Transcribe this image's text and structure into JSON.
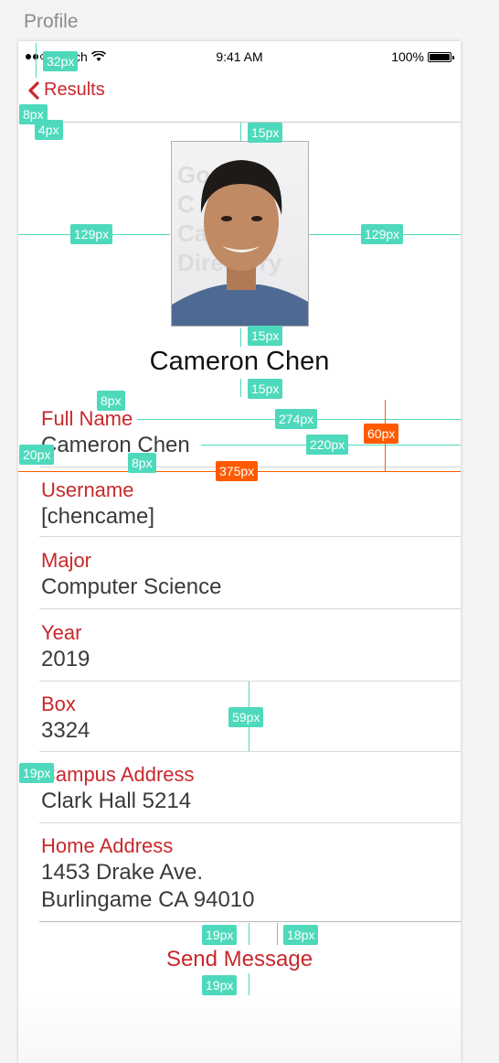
{
  "page_label": "Profile",
  "status_bar": {
    "carrier": "Sketch",
    "time": "9:41 AM",
    "battery": "100%"
  },
  "nav": {
    "back_label": "Results"
  },
  "photo": {
    "watermark_lines": [
      "Gordell",
      "C",
      "Campus",
      "Directory"
    ]
  },
  "profile": {
    "name": "Cameron Chen",
    "fields": [
      {
        "label": "Full Name",
        "value": "Cameron Chen"
      },
      {
        "label": "Username",
        "value": "[chencame]"
      },
      {
        "label": "Major",
        "value": "Computer Science"
      },
      {
        "label": "Year",
        "value": "2019"
      },
      {
        "label": "Box",
        "value": "3324"
      },
      {
        "label": "Campus Address",
        "value": "Clark Hall 5214"
      },
      {
        "label": "Home Address",
        "value_line1": "1453 Drake Ave.",
        "value_line2": "Burlingame CA 94010"
      }
    ]
  },
  "actions": {
    "send_message_label": "Send Message"
  },
  "measurements": {
    "m32": "32px",
    "m8a": "8px",
    "m4": "4px",
    "m15a": "15px",
    "m129a": "129px",
    "m129b": "129px",
    "m15b": "15px",
    "m15c": "15px",
    "m8b": "8px",
    "m274": "274px",
    "m60": "60px",
    "m20": "20px",
    "m220": "220px",
    "m8c": "8px",
    "m375": "375px",
    "m59": "59px",
    "m19a": "19px",
    "m19b": "19px",
    "m18": "18px",
    "m19c": "19px"
  },
  "colors": {
    "accent": "#c8282c",
    "measure": "#4ed9bc",
    "measure_alt": "#ff5a00"
  }
}
